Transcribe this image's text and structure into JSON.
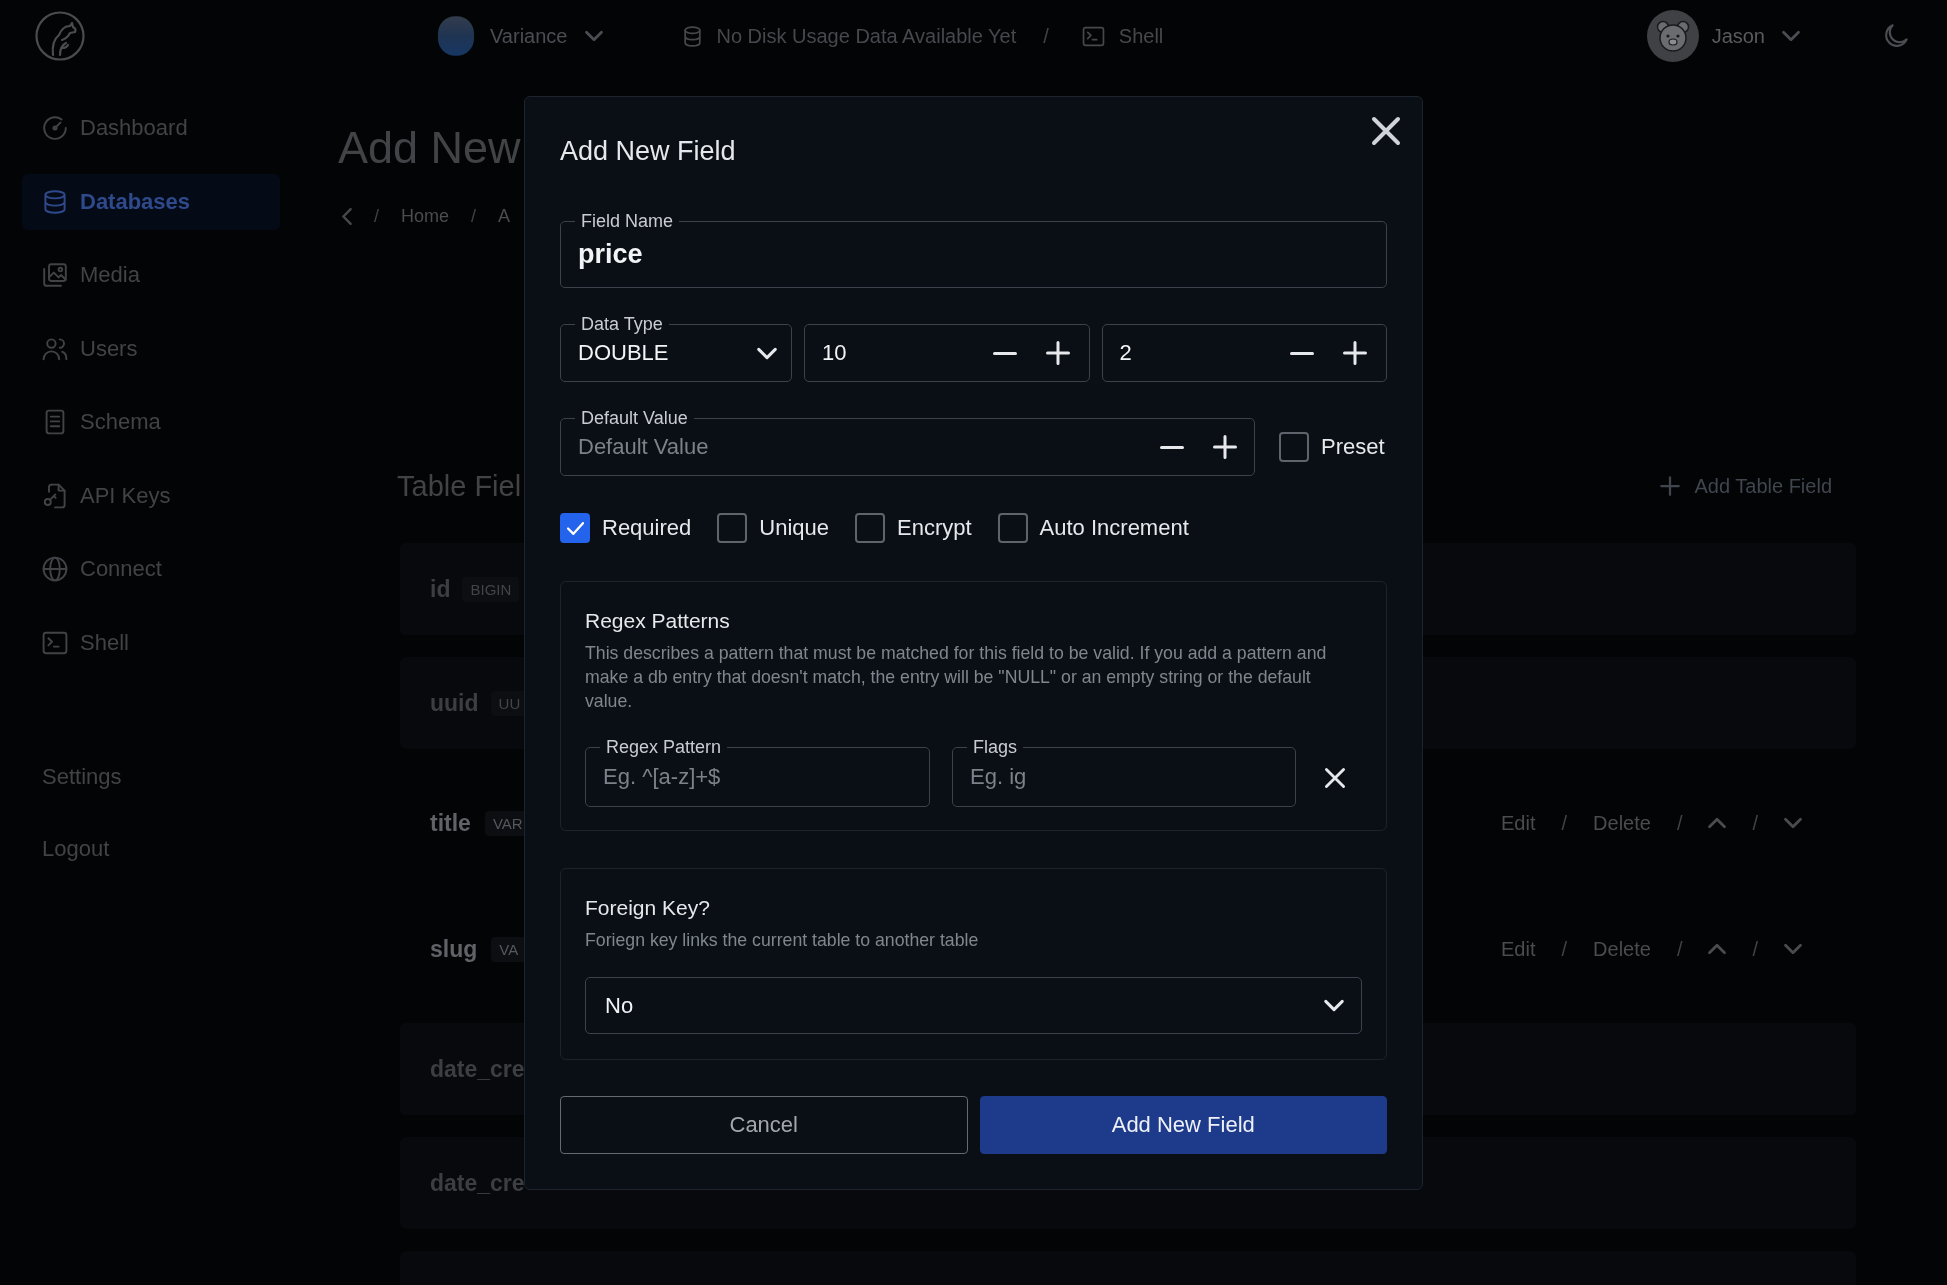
{
  "top_bar": {
    "project": "Variance",
    "disk_usage": "No Disk Usage Data Available Yet",
    "separator": "/",
    "shell": "Shell",
    "user": "Jason"
  },
  "sidebar": {
    "items": [
      {
        "kind": "dashboard",
        "label": "Dashboard",
        "selected": false
      },
      {
        "kind": "databases",
        "label": "Databases",
        "selected": true
      },
      {
        "kind": "media",
        "label": "Media",
        "selected": false
      },
      {
        "kind": "users",
        "label": "Users",
        "selected": false
      },
      {
        "kind": "schema",
        "label": "Schema",
        "selected": false
      },
      {
        "kind": "keys",
        "label": "API Keys",
        "selected": false
      },
      {
        "kind": "connect",
        "label": "Connect",
        "selected": false
      },
      {
        "kind": "shell",
        "label": "Shell",
        "selected": false
      }
    ],
    "footer_items": [
      {
        "label": "Settings"
      },
      {
        "label": "Logout"
      }
    ]
  },
  "page": {
    "title": "Add New",
    "breadcrumb": [
      {
        "kind": "back"
      },
      {
        "kind": "separator",
        "text": "/"
      },
      {
        "kind": "link",
        "text": "Home"
      },
      {
        "kind": "separator",
        "text": "/"
      },
      {
        "kind": "link",
        "text": "A"
      }
    ],
    "section_title": "Table Fiel",
    "add_button": "Add Table Field",
    "rows": [
      {
        "name": "id",
        "type": "BIGIN",
        "editable": false
      },
      {
        "name": "uuid",
        "type": "UU",
        "editable": false
      },
      {
        "name": "title",
        "type": "VAR",
        "editable": true,
        "actions": [
          {
            "kind": "link",
            "text": "Edit"
          },
          {
            "kind": "separator",
            "text": "/"
          },
          {
            "kind": "link",
            "text": "Delete"
          },
          {
            "kind": "separator",
            "text": "/"
          },
          {
            "kind": "up"
          },
          {
            "kind": "separator",
            "text": "/"
          },
          {
            "kind": "down"
          }
        ]
      },
      {
        "name": "slug",
        "type": "VA",
        "editable": true,
        "actions": [
          {
            "kind": "link",
            "text": "Edit"
          },
          {
            "kind": "separator",
            "text": "/"
          },
          {
            "kind": "link",
            "text": "Delete"
          },
          {
            "kind": "separator",
            "text": "/"
          },
          {
            "kind": "up"
          },
          {
            "kind": "separator",
            "text": "/"
          },
          {
            "kind": "down"
          }
        ]
      },
      {
        "name": "date_cre",
        "editable": false
      },
      {
        "name": "date_cre",
        "editable": false
      },
      {
        "editable": false
      }
    ]
  },
  "modal": {
    "title": "Add New Field",
    "field_name": {
      "label": "Field Name",
      "value": "price"
    },
    "data_type": {
      "label": "Data Type",
      "value": "DOUBLE"
    },
    "number_fields": [
      {
        "value": "10"
      },
      {
        "value": "2"
      }
    ],
    "default_value": {
      "label": "Default Value",
      "placeholder": "Default Value"
    },
    "preset": {
      "label": "Preset",
      "checked": false
    },
    "options": [
      {
        "label": "Required",
        "checked": true
      },
      {
        "label": "Unique",
        "checked": false
      },
      {
        "label": "Encrypt",
        "checked": false
      },
      {
        "label": "Auto Increment",
        "checked": false
      }
    ],
    "regex": {
      "title": "Regex Patterns",
      "description": "This describes a pattern that must be matched for this field to be valid. If you add a pattern and make a db entry that doesn't match, the entry will be \"NULL\" or an empty string or the default value.",
      "pattern": {
        "label": "Regex Pattern",
        "placeholder": "Eg. ^[a-z]+$"
      },
      "flags": {
        "label": "Flags",
        "placeholder": "Eg. ig"
      }
    },
    "foreign_key": {
      "title": "Foreign Key?",
      "description": "Foriegn key links the current table to another table",
      "value": "No"
    },
    "buttons": [
      {
        "kind": "secondary",
        "label": "Cancel"
      },
      {
        "kind": "primary",
        "label": "Add New Field"
      }
    ]
  }
}
